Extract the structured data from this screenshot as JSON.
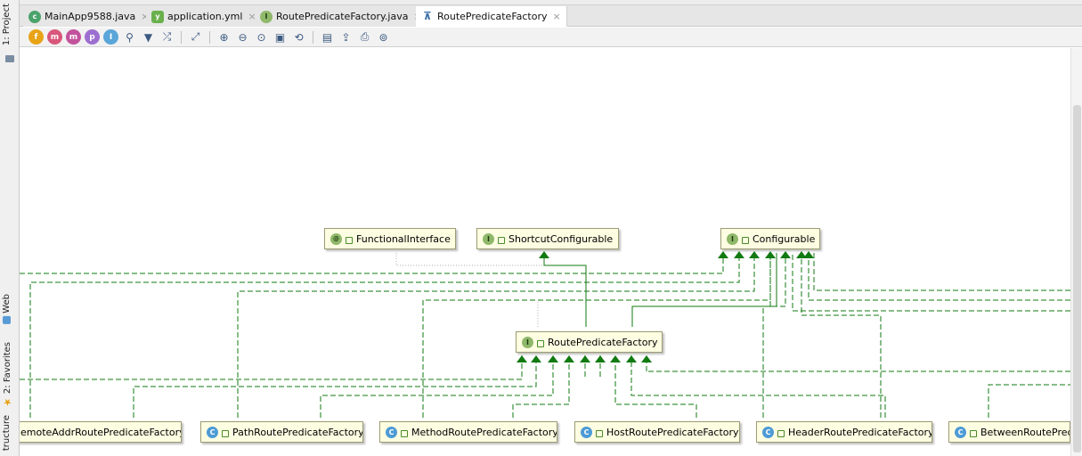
{
  "sidebar": {
    "project_label": "1: Project",
    "web_label": "Web",
    "favorites_label": "2: Favorites",
    "structure_label": "tructure"
  },
  "tabs": [
    {
      "label": "MainApp9588.java",
      "icon": "java-class-icon",
      "active": false
    },
    {
      "label": "application.yml",
      "icon": "yaml-file-icon",
      "active": false
    },
    {
      "label": "RoutePredicateFactory.java",
      "icon": "java-interface-icon",
      "active": false
    },
    {
      "label": "RoutePredicateFactory",
      "icon": "diagram-icon",
      "active": true
    }
  ],
  "toolbar": {
    "letters": [
      "f",
      "m",
      "m",
      "p",
      "I"
    ]
  },
  "diagram": {
    "nodes": [
      {
        "label": "FunctionalInterface",
        "kind": "@"
      },
      {
        "label": "ShortcutConfigurable",
        "kind": "I"
      },
      {
        "label": "Configurable",
        "kind": "I"
      },
      {
        "label": "RoutePredicateFactory",
        "kind": "I"
      },
      {
        "label": "emoteAddrRoutePredicateFactory",
        "kind": ""
      },
      {
        "label": "PathRoutePredicateFactory",
        "kind": "C"
      },
      {
        "label": "MethodRoutePredicateFactory",
        "kind": "C"
      },
      {
        "label": "HostRoutePredicateFactory",
        "kind": "C"
      },
      {
        "label": "HeaderRoutePredicateFactory",
        "kind": "C"
      },
      {
        "label": "BetweenRoutePredi",
        "kind": "C"
      }
    ]
  },
  "colors": {
    "arrow": "#117a11",
    "node_bg": "#fdfde2"
  }
}
